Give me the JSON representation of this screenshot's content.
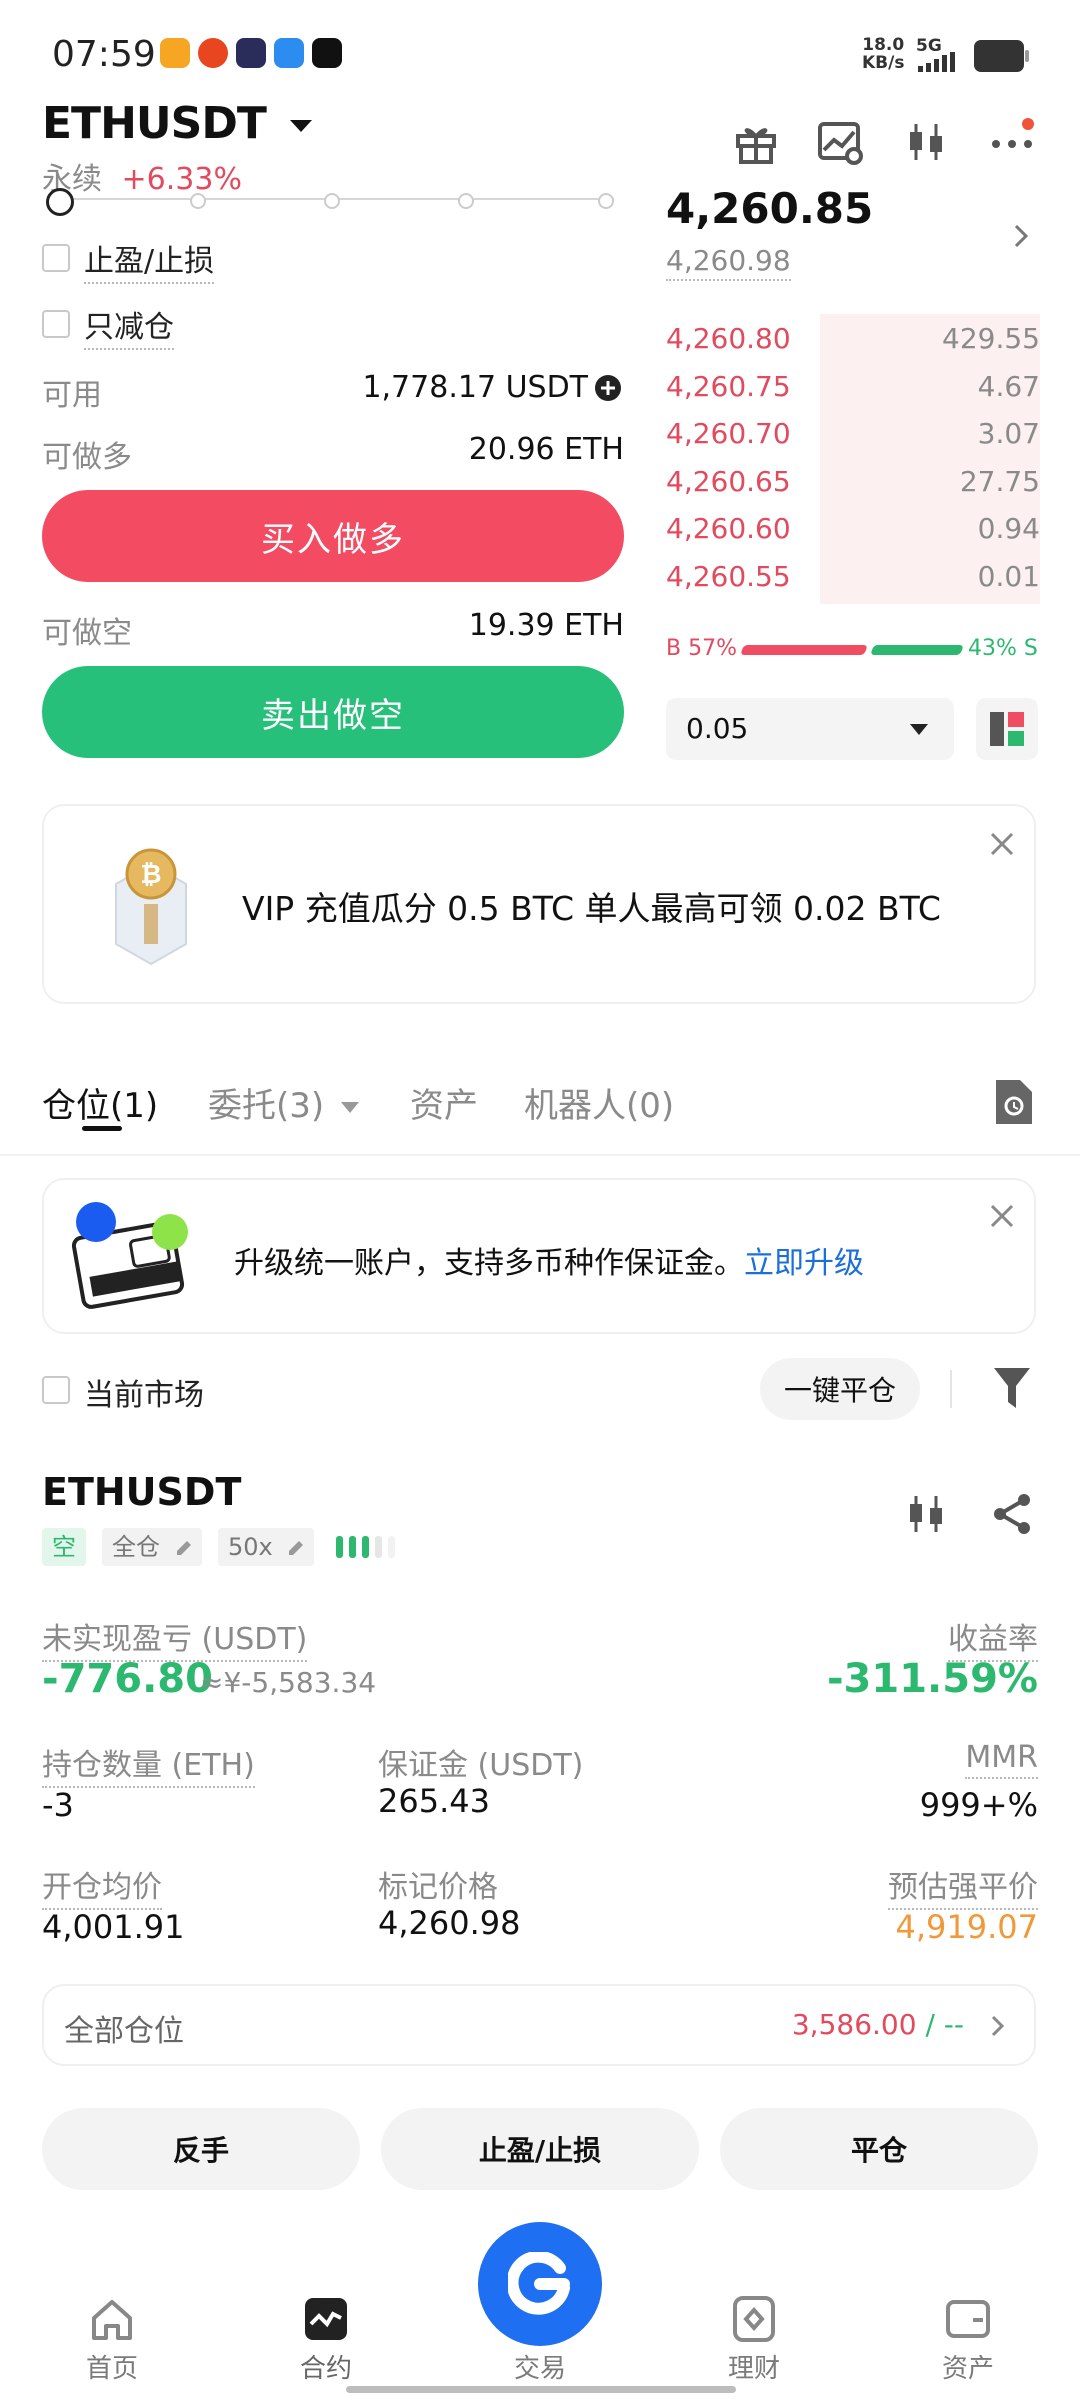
{
  "status_bar": {
    "time": "07:59",
    "net_speed_value": "18.0",
    "net_speed_unit": "KB/s",
    "network": "5G"
  },
  "header": {
    "pair": "ETHUSDT",
    "contract_type": "永续",
    "change": "+6.33%",
    "icons": [
      "gift-icon",
      "chart-settings-icon",
      "candlestick-icon",
      "more-icon"
    ]
  },
  "order_form": {
    "tp_sl_label": "止盈/止损",
    "reduce_only_label": "只减仓",
    "available_label": "可用",
    "available_value": "1,778.17 USDT",
    "long_capacity_label": "可做多",
    "long_capacity_value": "20.96 ETH",
    "buy_button": "买入做多",
    "short_capacity_label": "可做空",
    "short_capacity_value": "19.39 ETH",
    "sell_button": "卖出做空"
  },
  "order_book": {
    "last_price": "4,260.85",
    "mark_price": "4,260.98",
    "asks": [
      {
        "price": "4,260.80",
        "qty": "429.55",
        "depth": 1.0
      },
      {
        "price": "4,260.75",
        "qty": "4.67",
        "depth": 0.5
      },
      {
        "price": "4,260.70",
        "qty": "3.07",
        "depth": 0.5
      },
      {
        "price": "4,260.65",
        "qty": "27.75",
        "depth": 0.5
      },
      {
        "price": "4,260.60",
        "qty": "0.94",
        "depth": 0.5
      },
      {
        "price": "4,260.55",
        "qty": "0.01",
        "depth": 0.5
      }
    ],
    "buy_ratio": "B 57%",
    "sell_ratio": "43% S",
    "buy_ratio_value": 0.57,
    "precision_value": "0.05"
  },
  "promo_banner": {
    "text": "VIP 充值瓜分 0.5 BTC 单人最高可领 0.02 BTC"
  },
  "tabs": [
    {
      "label": "仓位",
      "count": "(1)",
      "active": true
    },
    {
      "label": "委托",
      "count": "(3)",
      "active": false
    },
    {
      "label": "资产",
      "count": "",
      "active": false
    },
    {
      "label": "机器人",
      "count": "(0)",
      "active": false
    }
  ],
  "upgrade_banner": {
    "text": "升级统一账户，支持多币种作保证金。",
    "link": "立即升级"
  },
  "filter_bar": {
    "current_market_label": "当前市场",
    "close_all_button": "一键平仓"
  },
  "position": {
    "symbol": "ETHUSDT",
    "side_tag": "空",
    "margin_mode_tag": "全仓",
    "leverage_tag": "50x",
    "unrealized_pnl_label": "未实现盈亏 (USDT)",
    "unrealized_pnl_value": "-776.80",
    "unrealized_pnl_cny": "≈¥-5,583.34",
    "roe_label": "收益率",
    "roe_value": "-311.59%",
    "size_label": "持仓数量 (ETH)",
    "size_value": "-3",
    "margin_label": "保证金 (USDT)",
    "margin_value": "265.43",
    "mmr_label": "MMR",
    "mmr_value": "999+%",
    "entry_price_label": "开仓均价",
    "entry_price_value": "4,001.91",
    "mark_price_label": "标记价格",
    "mark_price_value": "4,260.98",
    "liq_price_label": "预估强平价",
    "liq_price_value": "4,919.07",
    "all_positions_label": "全部仓位",
    "all_positions_value": "3,586.00",
    "all_positions_suffix": "/ --",
    "buttons": {
      "reverse": "反手",
      "tp_sl": "止盈/止损",
      "close": "平仓"
    }
  },
  "bottom_nav": [
    {
      "label": "首页",
      "icon": "home-icon"
    },
    {
      "label": "合约",
      "icon": "futures-icon"
    },
    {
      "label": "交易",
      "icon": "trade-icon"
    },
    {
      "label": "理财",
      "icon": "earn-icon"
    },
    {
      "label": "资产",
      "icon": "wallet-icon"
    }
  ],
  "colors": {
    "red": "#e24a5e",
    "green": "#2cb86f",
    "link_blue": "#1a6fd8",
    "trade_blue": "#1f6ff2",
    "orange": "#f0993a"
  }
}
